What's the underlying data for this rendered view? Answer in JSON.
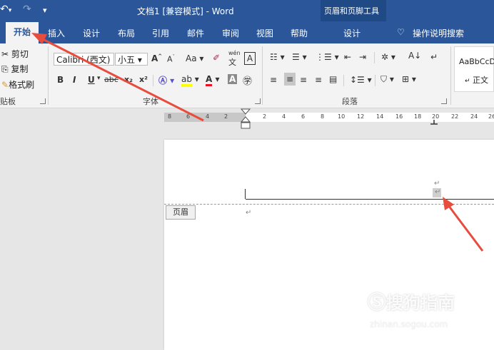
{
  "titlebar": {
    "title": "文档1 [兼容模式] - Word",
    "context_tools": "页眉和页脚工具",
    "undo_icon": "undo-icon",
    "redo_icon": "redo-icon",
    "customize": "▾"
  },
  "tabs": {
    "home": "开始",
    "insert": "插入",
    "design": "设计",
    "layout": "布局",
    "references": "引用",
    "mailings": "邮件",
    "review": "审阅",
    "view": "视图",
    "help": "帮助",
    "hf_design": "设计",
    "tell_me": "操作说明搜索"
  },
  "clipboard": {
    "cut": "剪切",
    "copy": "复制",
    "format_painter": "格式刷",
    "label": "贴板"
  },
  "font": {
    "name": "Calibri (西文)",
    "size": "小五",
    "label": "字体",
    "grow": "A",
    "shrink": "A",
    "change_case": "Aa",
    "phonetic": "wén",
    "bold": "B",
    "italic": "I",
    "underline": "U",
    "strike": "abc",
    "subscript": "x₂",
    "superscript": "x²"
  },
  "paragraph": {
    "label": "段落"
  },
  "styles": {
    "preview": "AaBbCcD",
    "normal": "正文"
  },
  "ruler": {
    "left_ticks": [
      "8",
      "6",
      "4",
      "2"
    ],
    "right_ticks": [
      "2",
      "4",
      "6",
      "8",
      "10",
      "12",
      "14",
      "16",
      "18",
      "20",
      "22",
      "24",
      "26"
    ]
  },
  "document": {
    "header_tag": "页眉",
    "para_mark": "↵"
  },
  "watermark": {
    "main": "搜狗指南",
    "sub": "zhinan.sogou.com"
  },
  "colors": {
    "accent": "#2b579a",
    "arrow": "#e84c3d"
  }
}
